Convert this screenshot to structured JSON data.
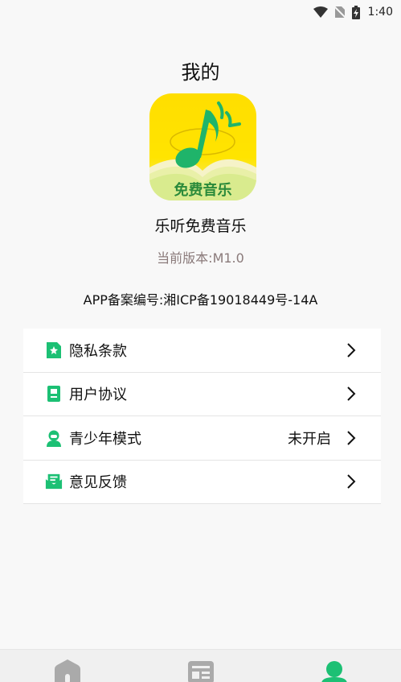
{
  "status_bar": {
    "time": "1:40"
  },
  "header": {
    "title": "我的"
  },
  "app": {
    "icon_text": "免费音乐",
    "name": "乐听免费音乐",
    "version": "当前版本:M1.0",
    "icp": "APP备案编号:湘ICP备19018449号-14A"
  },
  "menu": {
    "items": [
      {
        "label": "隐私条款",
        "icon": "privacy-doc-icon",
        "value": ""
      },
      {
        "label": "用户协议",
        "icon": "agreement-doc-icon",
        "value": ""
      },
      {
        "label": "青少年模式",
        "icon": "child-face-icon",
        "value": "未开启"
      },
      {
        "label": "意见反馈",
        "icon": "feedback-mail-icon",
        "value": ""
      }
    ]
  },
  "bottom_nav": {
    "tabs": [
      {
        "icon": "home-icon",
        "active": false
      },
      {
        "icon": "news-icon",
        "active": false
      },
      {
        "icon": "user-icon",
        "active": true
      }
    ]
  },
  "colors": {
    "accent_green": "#1cc074",
    "icon_yellow": "#ffd800",
    "inactive_gray": "#aaaaaa",
    "background": "#f8f8f8"
  }
}
